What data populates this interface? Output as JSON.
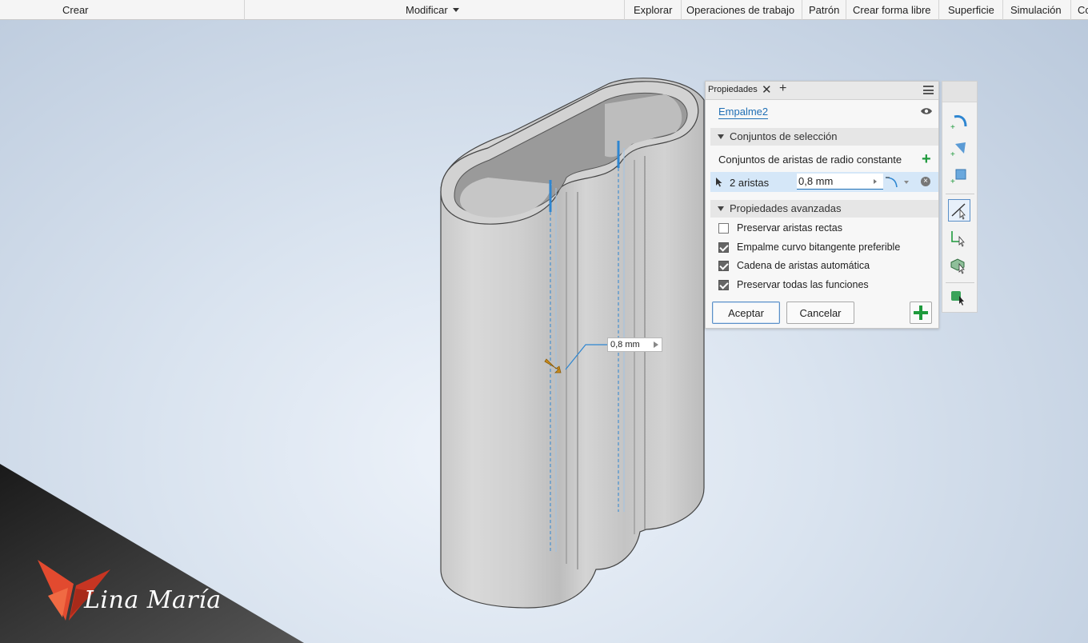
{
  "ribbon": {
    "crear": "Crear",
    "modificar": "Modificar",
    "explorar": "Explorar",
    "operaciones": "Operaciones de trabajo",
    "patron": "Patrón",
    "forma_libre": "Crear forma libre",
    "superficie": "Superficie",
    "simulacion": "Simulación",
    "cut": "Co"
  },
  "properties": {
    "tab_label": "Propiedades",
    "feature_name": "Empalme2",
    "section_selection": "Conjuntos de selección",
    "constant_radius_label": "Conjuntos de aristas de radio constante",
    "edge_count": "2 aristas",
    "radius_value": "0,8 mm",
    "section_advanced": "Propiedades avanzadas",
    "options": [
      {
        "label": "Preservar aristas rectas",
        "checked": false
      },
      {
        "label": "Empalme curvo bitangente preferible",
        "checked": true
      },
      {
        "label": "Cadena de aristas automática",
        "checked": true
      },
      {
        "label": "Preservar todas las funciones",
        "checked": true
      }
    ],
    "ok_label": "Aceptar",
    "cancel_label": "Cancelar"
  },
  "viewport": {
    "dimension_value": "0,8 mm"
  },
  "watermark": "Lina María",
  "icons": {
    "tab_close": "close-icon",
    "tab_add": "add-tab-icon",
    "menu": "hamburger-menu-icon",
    "visibility": "eye-icon",
    "add_set": "plus-icon",
    "select": "cursor-arrow-icon",
    "fillet_type": "fillet-curve-icon",
    "remove": "remove-circle-icon"
  },
  "colors": {
    "accent": "#1f6fb5",
    "add_green": "#1e9a3c",
    "selection_row": "#d5e7f8"
  }
}
